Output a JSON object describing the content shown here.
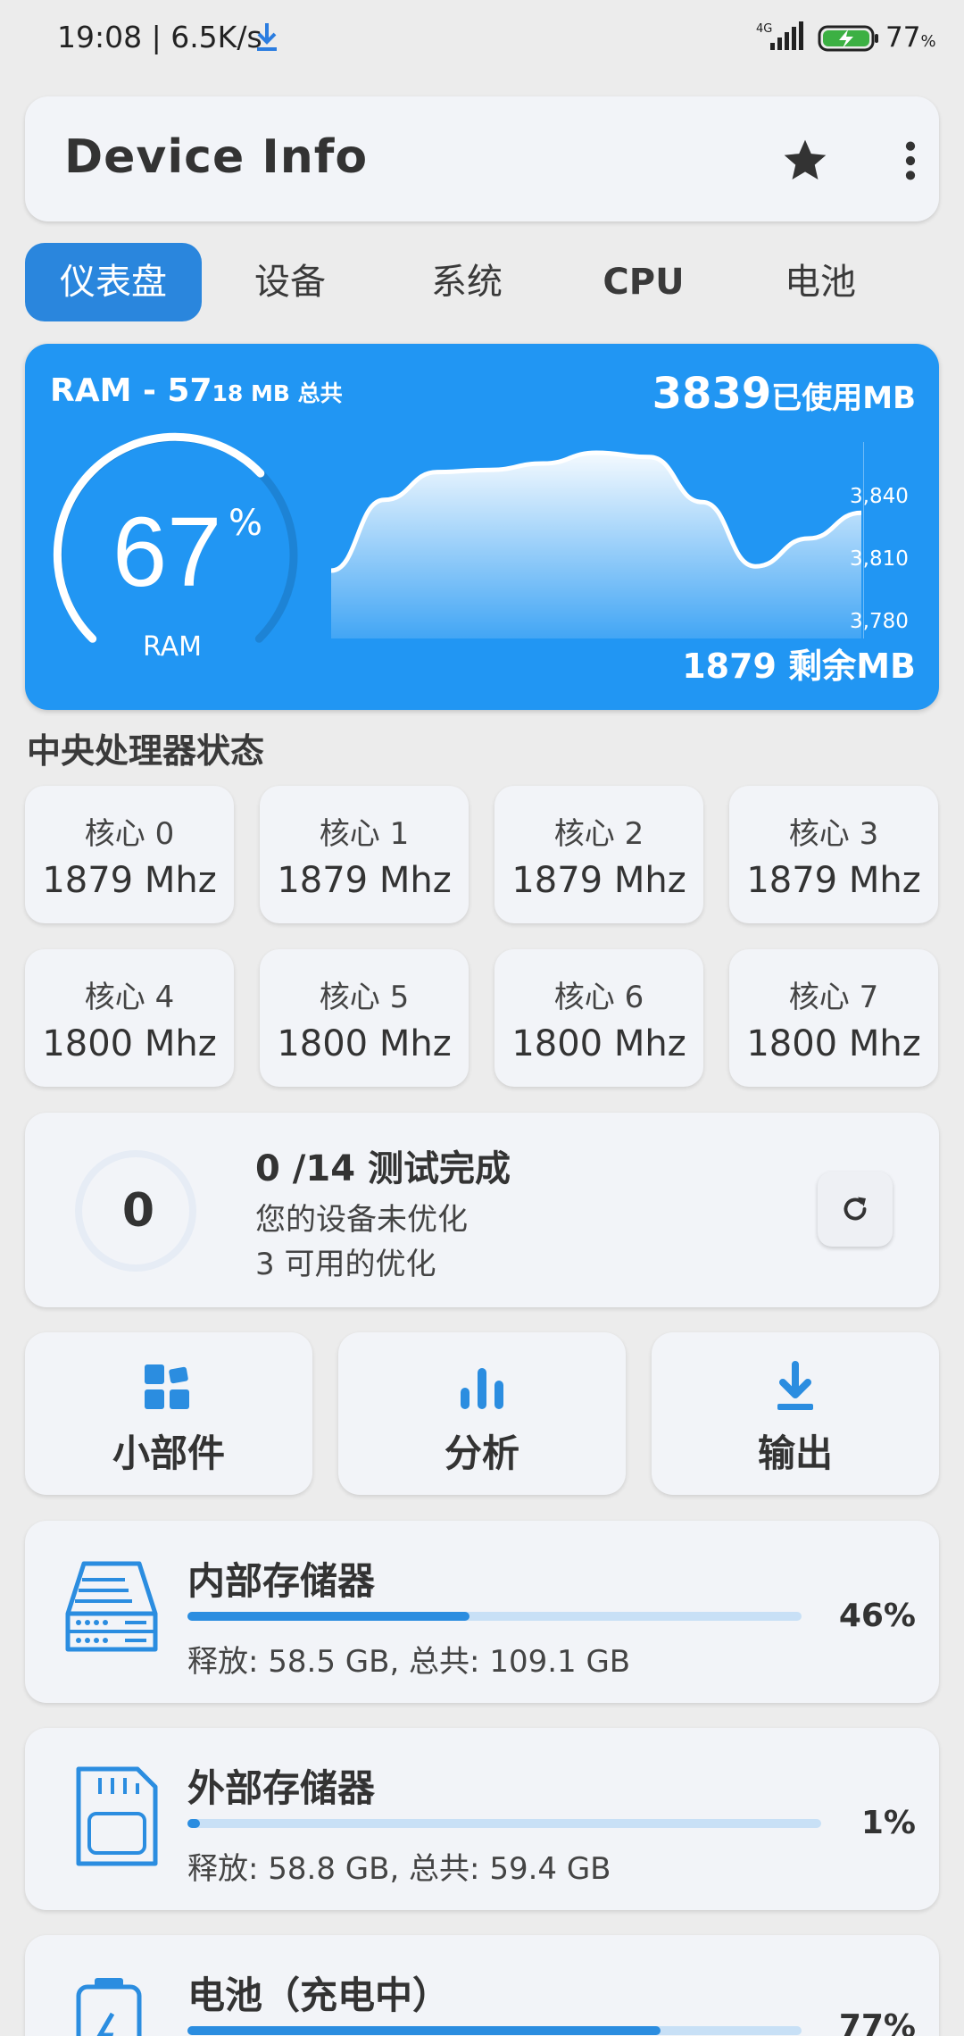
{
  "status_bar": {
    "time_speed": "19:08 | 6.5K/s",
    "network": "4G",
    "battery_level": "77",
    "battery_unit": "%"
  },
  "app_bar": {
    "title": "Device Info",
    "star_icon": "star-icon",
    "more_icon": "more-vert-icon"
  },
  "tabs": [
    {
      "label": "仪表盘",
      "active": true
    },
    {
      "label": "设备",
      "active": false
    },
    {
      "label": "系统",
      "active": false
    },
    {
      "label": "CPU",
      "active": false
    },
    {
      "label": "电池",
      "active": false
    }
  ],
  "ram": {
    "title": "RAM - 57",
    "total": "18 MB 总共",
    "used_value": "3839",
    "used_label": "已使用MB",
    "percent": "67",
    "percent_sign": "%",
    "percent_fraction": 0.67,
    "gauge_label": "RAM",
    "free_value": "1879",
    "free_label": "剩余MB",
    "y_ticks": [
      "3,840",
      "3,810",
      "3,780"
    ]
  },
  "chart_data": {
    "type": "area",
    "y_ticks": [
      3840,
      3810,
      3780
    ],
    "ylim": [
      3770,
      3845
    ],
    "x": [
      0,
      1,
      2,
      3,
      4,
      5,
      6,
      7,
      8,
      9,
      10
    ],
    "values": [
      3785,
      3818,
      3831,
      3832,
      3835,
      3840,
      3838,
      3817,
      3787,
      3800,
      3812
    ],
    "title": "",
    "xlabel": "",
    "ylabel": ""
  },
  "cpu": {
    "section_title": "中央处理器状态",
    "cores": [
      {
        "name": "核心 0",
        "freq": "1879 Mhz"
      },
      {
        "name": "核心 1",
        "freq": "1879 Mhz"
      },
      {
        "name": "核心 2",
        "freq": "1879 Mhz"
      },
      {
        "name": "核心 3",
        "freq": "1879 Mhz"
      },
      {
        "name": "核心 4",
        "freq": "1800 Mhz"
      },
      {
        "name": "核心 5",
        "freq": "1800 Mhz"
      },
      {
        "name": "核心 6",
        "freq": "1800 Mhz"
      },
      {
        "name": "核心 7",
        "freq": "1800 Mhz"
      }
    ]
  },
  "optimization": {
    "count": "0",
    "title": "0 /14 测试完成",
    "line1": "您的设备未优化",
    "line2": "3 可用的优化",
    "refresh_icon": "refresh-icon"
  },
  "actions": [
    {
      "label": "小部件",
      "icon": "widgets-icon"
    },
    {
      "label": "分析",
      "icon": "bar-chart-icon"
    },
    {
      "label": "输出",
      "icon": "download-icon"
    }
  ],
  "storage": [
    {
      "title": "内部存储器",
      "detail": "释放: 58.5 GB,  总共: 109.1 GB",
      "percent": "46%",
      "fraction": 0.46,
      "icon": "hard-drive-icon"
    },
    {
      "title": "外部存储器",
      "detail": "释放: 58.8 GB,  总共: 59.4 GB",
      "percent": "1%",
      "fraction": 0.01,
      "icon": "sd-card-icon"
    },
    {
      "title": "电池（充电中）",
      "detail": "",
      "percent": "77%",
      "fraction": 0.77,
      "icon": "battery-icon"
    }
  ],
  "colors": {
    "accent": "#2196f3",
    "tab_active": "#2a86dd",
    "bar_fill": "#2b8de0",
    "bar_track": "#c8e0f6",
    "battery_green": "#3cb043"
  }
}
